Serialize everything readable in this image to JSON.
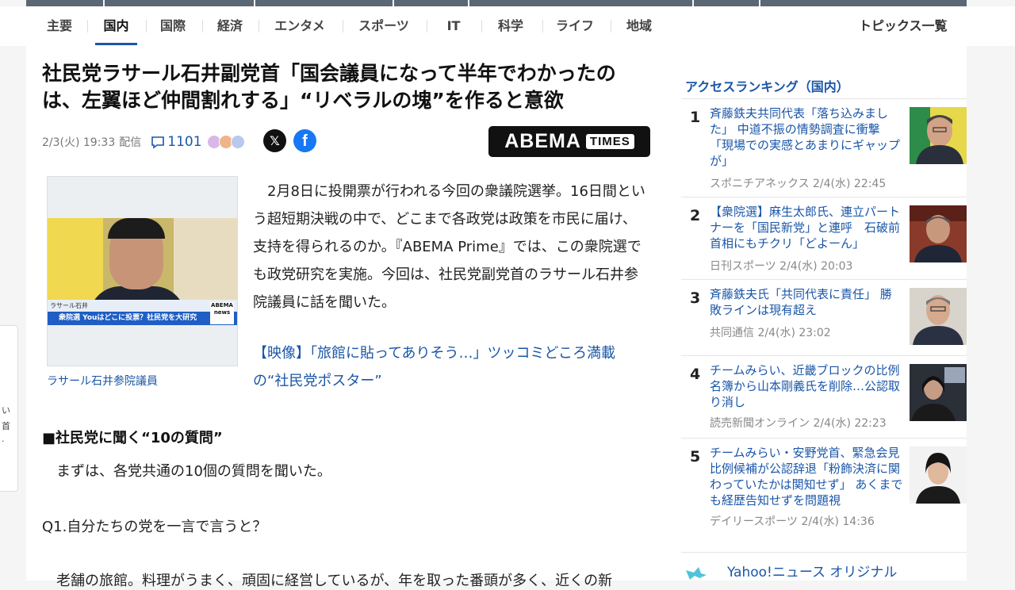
{
  "nav": {
    "items": [
      "主要",
      "国内",
      "国際",
      "経済",
      "エンタメ",
      "スポーツ",
      "IT",
      "科学",
      "ライフ",
      "地域"
    ],
    "active_index": 1,
    "topics_label": "トピックス一覧"
  },
  "article": {
    "headline": "社民党ラサール石井副党首「国会議員になって半年でわかったのは、左翼ほど仲間割れする」“リベラルの塊”を作ると意欲",
    "date": "2/3(火) 19:33",
    "distribution": "配信",
    "comment_count": "1101",
    "x_glyph": "𝕏",
    "fb_glyph": "f",
    "source_logo": {
      "main": "ABEMA",
      "sub": "TIMES"
    },
    "photo_lower_name": "ラサール石井",
    "photo_caption_bar": "衆院選 Youはどこに投票？社民党を大研究",
    "photo_news_logo": "ABEMA news",
    "photo_caption": "ラサール石井参院議員",
    "body_paragraph": "　2月8日に投開票が行われる今回の衆議院選挙。16日間という超短期決戦の中で、どこまで各政党は政策を市民に届け、支持を得られるのか。『ABEMA Prime』では、この衆院選でも政党研究を実施。今回は、社民党副党首のラサール石井参院議員に話を聞いた。",
    "related_link": "【映像】「旅館に貼ってありそう…」ツッコミどころ満載の“社民党ポスター”",
    "section_heading": "■社民党に聞く“10の質問”",
    "paragraph2": "　まずは、各党共通の10個の質問を聞いた。",
    "q1": "Q1.自分たちの党を一言で言うと？",
    "paragraph3": "　老舗の旅館。料理がうまく、頑固に経営しているが、年を取った番頭が多く、近くの新"
  },
  "sidebar": {
    "ranking_title": "アクセスランキング（国内）",
    "ranking": [
      {
        "rank": "1",
        "title": "斉藤鉄夫共同代表「落ち込みました」 中道不振の情勢調査に衝撃「現場での実感とあまりにギャップが」",
        "source": "スポニチアネックス 2/4(水) 22:45"
      },
      {
        "rank": "2",
        "title": "【衆院選】麻生太郎氏、連立パートナーを「国民新党」と連呼　石破前首相にもチクリ「どよーん」",
        "source": "日刊スポーツ 2/4(水) 20:03"
      },
      {
        "rank": "3",
        "title": "斉藤鉄夫氏「共同代表に責任」 勝敗ラインは現有超え",
        "source": "共同通信 2/4(水) 23:02"
      },
      {
        "rank": "4",
        "title": "チームみらい、近畿ブロックの比例名簿から山本剛義氏を削除…公認取り消し",
        "source": "読売新聞オンライン 2/4(水) 22:23"
      },
      {
        "rank": "5",
        "title": "チームみらい・安野党首、緊急会見　比例候補が公認辞退「粉飾決済に関わっていたかは関知せず」 あくまでも経歴告知せずを問題視",
        "source": "デイリースポーツ 2/4(水) 14:36"
      }
    ],
    "original_label": "Yahoo!ニュース オリジナル"
  },
  "leftcut": {
    "chars": [
      "い",
      "首",
      "."
    ]
  },
  "colors": {
    "link": "#1a56a8",
    "nav_active": "#1a56a8"
  }
}
